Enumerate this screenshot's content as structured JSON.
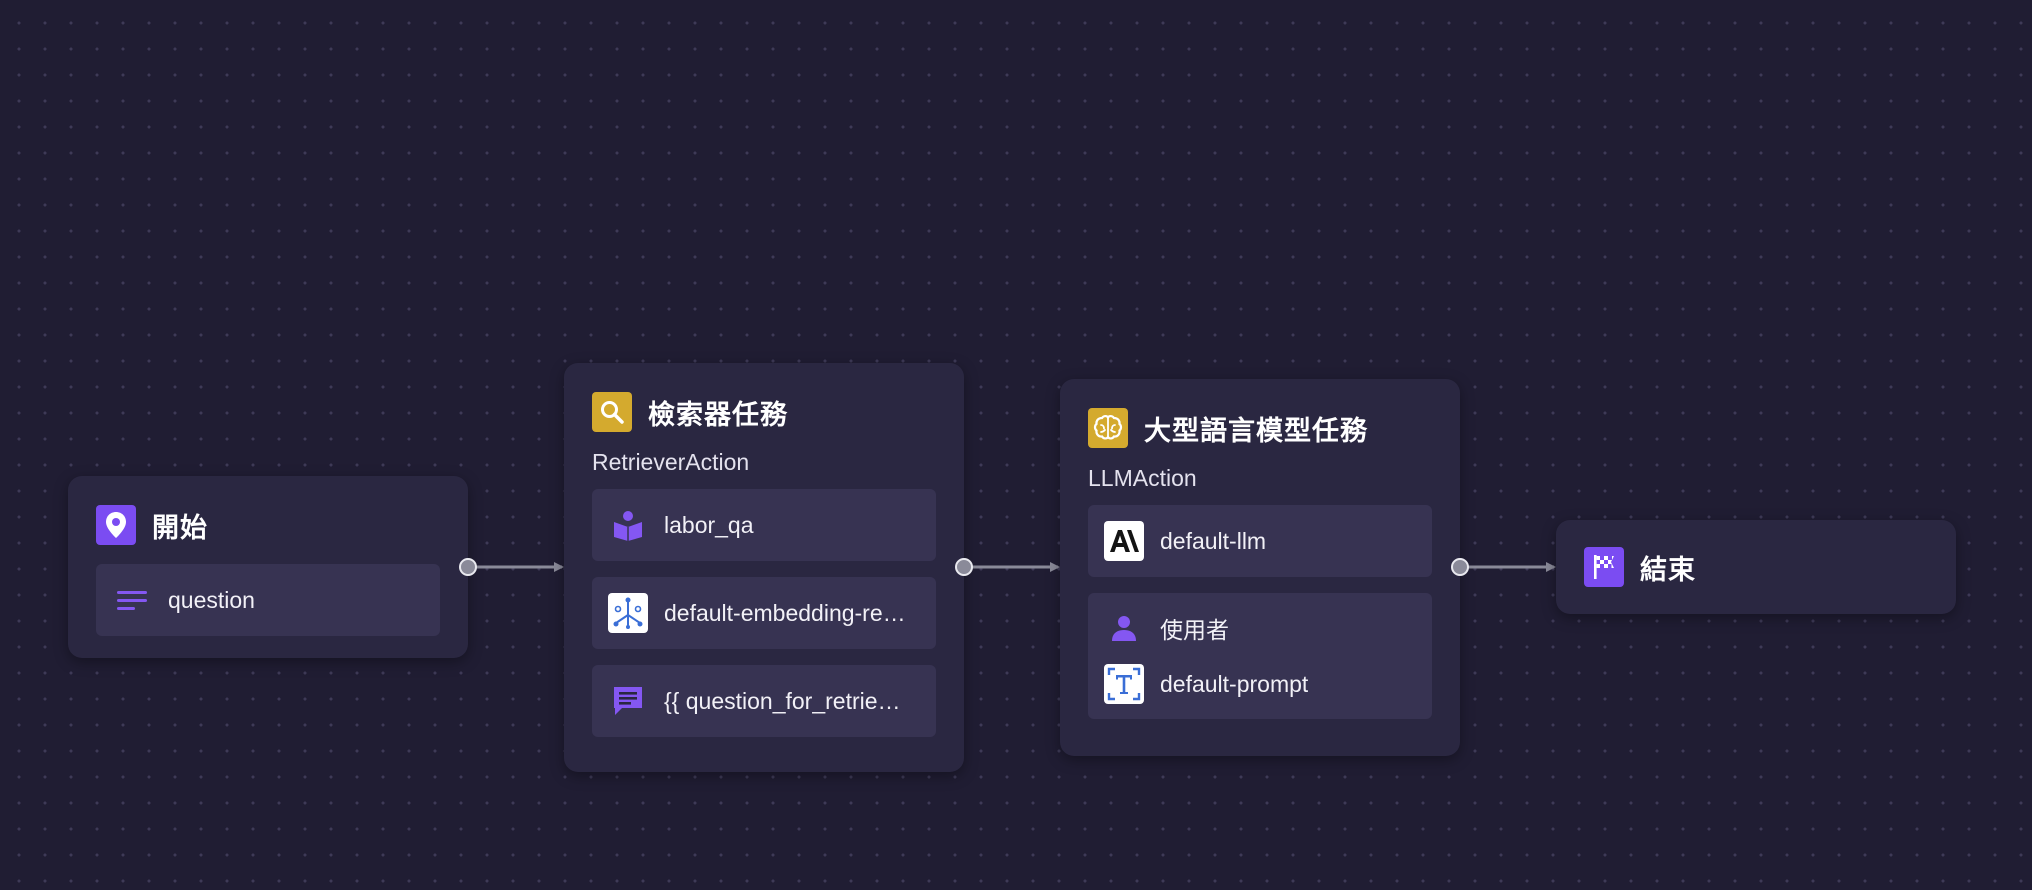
{
  "nodes": {
    "start": {
      "title": "開始",
      "items": [
        {
          "label": "question",
          "icon": "text-lines-icon"
        }
      ]
    },
    "retriever": {
      "title": "檢索器任務",
      "subtitle": "RetrieverAction",
      "items": [
        {
          "label": "labor_qa",
          "icon": "knowledge-book-icon"
        },
        {
          "label": "default-embedding-re…",
          "icon": "embedding-model-icon"
        },
        {
          "label": "{{ question_for_retrie…",
          "icon": "chat-message-icon"
        }
      ]
    },
    "llm": {
      "title": "大型語言模型任務",
      "subtitle": "LLMAction",
      "model": {
        "label": "default-llm",
        "icon": "anthropic-logo-icon"
      },
      "prompt_group": [
        {
          "label": "使用者",
          "icon": "user-icon"
        },
        {
          "label": "default-prompt",
          "icon": "text-template-icon"
        }
      ]
    },
    "end": {
      "title": "結束"
    }
  },
  "colors": {
    "canvas_background": "#201d33",
    "node_background": "#2a2741",
    "item_background": "#373352",
    "accent_purple": "#7b4cf2",
    "accent_yellow": "#d4aa2e",
    "edge": "#8a8a99"
  }
}
